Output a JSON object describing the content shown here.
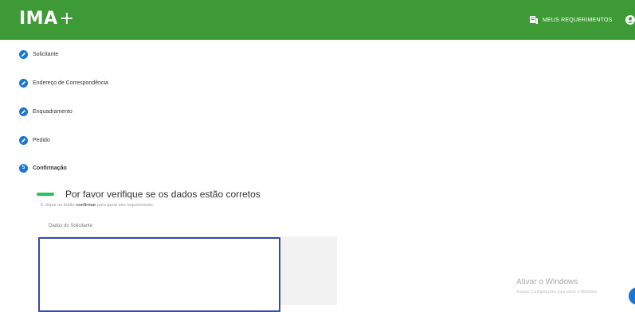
{
  "header": {
    "logo_text": "IMA",
    "logo_plus": "+",
    "requests_label": "MEUS REQUERIMENTOS",
    "requests_icon": "document-list-icon",
    "account_icon": "account-circle-icon",
    "brand_color": "#3d9a35"
  },
  "steps": [
    {
      "label": "Solicitante",
      "state": "completed",
      "icon": "pencil-icon"
    },
    {
      "label": "Endereço de Correspondência",
      "state": "completed",
      "icon": "pencil-icon"
    },
    {
      "label": "Enquadramento",
      "state": "completed",
      "icon": "pencil-icon"
    },
    {
      "label": "Pedido",
      "state": "completed",
      "icon": "pencil-icon"
    },
    {
      "label": "Confirmação",
      "state": "active",
      "number": "5"
    }
  ],
  "confirmation": {
    "title": "Por favor verifique se os dados estão corretos",
    "hint_prefix": "E clique no botão",
    "hint_bold": "confirmar",
    "hint_suffix": "para gerar seu requerimento.",
    "section_label": "Dados do Solicitante"
  },
  "watermark": {
    "title": "Ativar o Windows",
    "subtitle": "Acesse Configurações para ativar o Windows."
  },
  "colors": {
    "step_circle": "#1976d2",
    "accent_bar": "#22c55e",
    "box_border": "#3949ab"
  }
}
